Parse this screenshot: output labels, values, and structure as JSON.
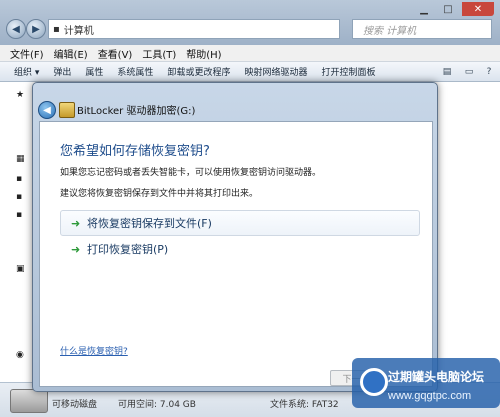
{
  "explorer": {
    "address_path": "计算机",
    "search_placeholder": "搜索 计算机",
    "menu": [
      "文件(F)",
      "编辑(E)",
      "查看(V)",
      "工具(T)",
      "帮助(H)"
    ],
    "toolbar": [
      "组织 ▾",
      "弹出",
      "属性",
      "系统属性",
      "卸载或更改程序",
      "映射网络驱动器",
      "打开控制面板"
    ],
    "status": {
      "drive_type": "可移动磁盘",
      "free_space": "可用空间: 7.04 GB",
      "filesystem": "文件系统: FAT32"
    }
  },
  "dialog": {
    "title": "BitLocker 驱动器加密(G:)",
    "heading": "您希望如何存储恢复密钥?",
    "desc1": "如果您忘记密码或者丢失智能卡，可以使用恢复密钥访问驱动器。",
    "desc2": "建议您将恢复密钥保存到文件中并将其打印出来。",
    "options": [
      {
        "label": "将恢复密钥保存到文件(F)"
      },
      {
        "label": "打印恢复密钥(P)"
      }
    ],
    "help_link": "什么是恢复密钥?",
    "next_button": "下一步"
  },
  "watermark": {
    "title": "过期罐头电脑论坛",
    "url": "www.gqgtpc.com"
  }
}
